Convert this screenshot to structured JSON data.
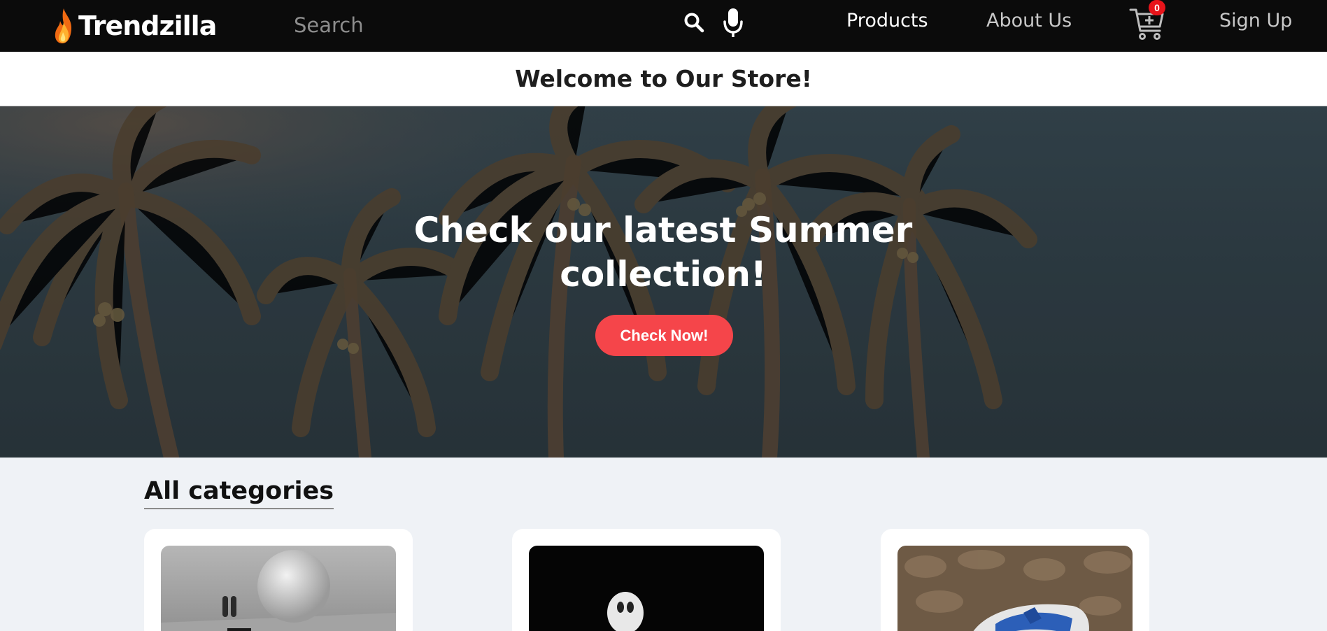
{
  "brand": {
    "name": "Trendzilla",
    "logo_icon": "flame-icon"
  },
  "search": {
    "placeholder": "Search",
    "value": "",
    "search_icon": "search-icon",
    "mic_icon": "microphone-icon"
  },
  "nav": {
    "products": "Products",
    "about": "About Us",
    "signup": "Sign Up"
  },
  "cart": {
    "icon": "shopping-cart-icon",
    "count": "0"
  },
  "welcome": {
    "title": "Welcome to Our Store!"
  },
  "hero": {
    "title": "Check our latest Summer collection!",
    "button_label": "Check Now!"
  },
  "categories": {
    "title": "All categories"
  },
  "colors": {
    "navbar": "#0b0b0b",
    "accent": "#f5454a",
    "badge": "#e8141a",
    "page_bg": "#eff2f6"
  }
}
